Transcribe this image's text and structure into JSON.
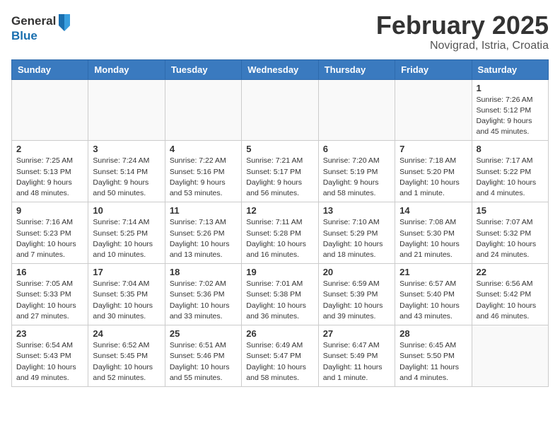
{
  "header": {
    "logo_general": "General",
    "logo_blue": "Blue",
    "month_title": "February 2025",
    "location": "Novigrad, Istria, Croatia"
  },
  "days_of_week": [
    "Sunday",
    "Monday",
    "Tuesday",
    "Wednesday",
    "Thursday",
    "Friday",
    "Saturday"
  ],
  "weeks": [
    [
      {
        "day": "",
        "info": ""
      },
      {
        "day": "",
        "info": ""
      },
      {
        "day": "",
        "info": ""
      },
      {
        "day": "",
        "info": ""
      },
      {
        "day": "",
        "info": ""
      },
      {
        "day": "",
        "info": ""
      },
      {
        "day": "1",
        "info": "Sunrise: 7:26 AM\nSunset: 5:12 PM\nDaylight: 9 hours and 45 minutes."
      }
    ],
    [
      {
        "day": "2",
        "info": "Sunrise: 7:25 AM\nSunset: 5:13 PM\nDaylight: 9 hours and 48 minutes."
      },
      {
        "day": "3",
        "info": "Sunrise: 7:24 AM\nSunset: 5:14 PM\nDaylight: 9 hours and 50 minutes."
      },
      {
        "day": "4",
        "info": "Sunrise: 7:22 AM\nSunset: 5:16 PM\nDaylight: 9 hours and 53 minutes."
      },
      {
        "day": "5",
        "info": "Sunrise: 7:21 AM\nSunset: 5:17 PM\nDaylight: 9 hours and 56 minutes."
      },
      {
        "day": "6",
        "info": "Sunrise: 7:20 AM\nSunset: 5:19 PM\nDaylight: 9 hours and 58 minutes."
      },
      {
        "day": "7",
        "info": "Sunrise: 7:18 AM\nSunset: 5:20 PM\nDaylight: 10 hours and 1 minute."
      },
      {
        "day": "8",
        "info": "Sunrise: 7:17 AM\nSunset: 5:22 PM\nDaylight: 10 hours and 4 minutes."
      }
    ],
    [
      {
        "day": "9",
        "info": "Sunrise: 7:16 AM\nSunset: 5:23 PM\nDaylight: 10 hours and 7 minutes."
      },
      {
        "day": "10",
        "info": "Sunrise: 7:14 AM\nSunset: 5:25 PM\nDaylight: 10 hours and 10 minutes."
      },
      {
        "day": "11",
        "info": "Sunrise: 7:13 AM\nSunset: 5:26 PM\nDaylight: 10 hours and 13 minutes."
      },
      {
        "day": "12",
        "info": "Sunrise: 7:11 AM\nSunset: 5:28 PM\nDaylight: 10 hours and 16 minutes."
      },
      {
        "day": "13",
        "info": "Sunrise: 7:10 AM\nSunset: 5:29 PM\nDaylight: 10 hours and 18 minutes."
      },
      {
        "day": "14",
        "info": "Sunrise: 7:08 AM\nSunset: 5:30 PM\nDaylight: 10 hours and 21 minutes."
      },
      {
        "day": "15",
        "info": "Sunrise: 7:07 AM\nSunset: 5:32 PM\nDaylight: 10 hours and 24 minutes."
      }
    ],
    [
      {
        "day": "16",
        "info": "Sunrise: 7:05 AM\nSunset: 5:33 PM\nDaylight: 10 hours and 27 minutes."
      },
      {
        "day": "17",
        "info": "Sunrise: 7:04 AM\nSunset: 5:35 PM\nDaylight: 10 hours and 30 minutes."
      },
      {
        "day": "18",
        "info": "Sunrise: 7:02 AM\nSunset: 5:36 PM\nDaylight: 10 hours and 33 minutes."
      },
      {
        "day": "19",
        "info": "Sunrise: 7:01 AM\nSunset: 5:38 PM\nDaylight: 10 hours and 36 minutes."
      },
      {
        "day": "20",
        "info": "Sunrise: 6:59 AM\nSunset: 5:39 PM\nDaylight: 10 hours and 39 minutes."
      },
      {
        "day": "21",
        "info": "Sunrise: 6:57 AM\nSunset: 5:40 PM\nDaylight: 10 hours and 43 minutes."
      },
      {
        "day": "22",
        "info": "Sunrise: 6:56 AM\nSunset: 5:42 PM\nDaylight: 10 hours and 46 minutes."
      }
    ],
    [
      {
        "day": "23",
        "info": "Sunrise: 6:54 AM\nSunset: 5:43 PM\nDaylight: 10 hours and 49 minutes."
      },
      {
        "day": "24",
        "info": "Sunrise: 6:52 AM\nSunset: 5:45 PM\nDaylight: 10 hours and 52 minutes."
      },
      {
        "day": "25",
        "info": "Sunrise: 6:51 AM\nSunset: 5:46 PM\nDaylight: 10 hours and 55 minutes."
      },
      {
        "day": "26",
        "info": "Sunrise: 6:49 AM\nSunset: 5:47 PM\nDaylight: 10 hours and 58 minutes."
      },
      {
        "day": "27",
        "info": "Sunrise: 6:47 AM\nSunset: 5:49 PM\nDaylight: 11 hours and 1 minute."
      },
      {
        "day": "28",
        "info": "Sunrise: 6:45 AM\nSunset: 5:50 PM\nDaylight: 11 hours and 4 minutes."
      },
      {
        "day": "",
        "info": ""
      }
    ]
  ]
}
